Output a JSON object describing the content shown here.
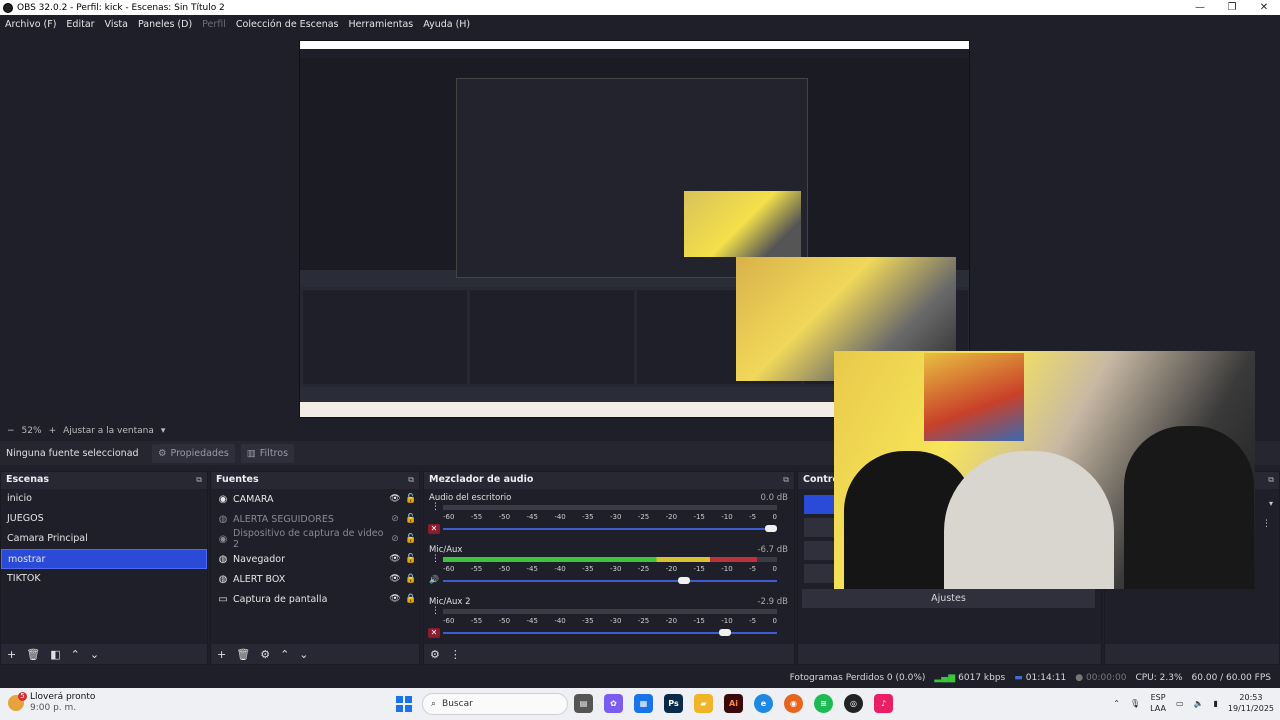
{
  "window": {
    "title": "OBS 32.0.2 - Perfil: kick - Escenas: Sin Título 2",
    "minimize": "—",
    "maximize": "❐",
    "close": "✕"
  },
  "menu": [
    "Archivo (F)",
    "Editar",
    "Vista",
    "Paneles (D)",
    "Perfil",
    "Colección de Escenas",
    "Herramientas",
    "Ayuda (H)"
  ],
  "zoom": {
    "minus": "−",
    "value": "52%",
    "plus": "+",
    "fit": "Ajustar a la ventana"
  },
  "properties_bar": {
    "no_selection": "Ninguna fuente seleccionad",
    "properties": "Propiedades",
    "filters": "Filtros"
  },
  "scenes": {
    "title": "Escenas",
    "items": [
      "inicio",
      "JUEGOS",
      "Camara Principal",
      "mostrar",
      "TIKTOK"
    ],
    "active_index": 3
  },
  "sources": {
    "title": "Fuentes",
    "items": [
      {
        "name": "CAMARA",
        "icon": "camera-icon",
        "visible": true,
        "locked": false
      },
      {
        "name": "ALERTA SEGUIDORES",
        "icon": "globe-icon",
        "visible": false,
        "locked": false
      },
      {
        "name": "Dispositivo de captura de video 2",
        "icon": "camera-icon",
        "visible": false,
        "locked": false
      },
      {
        "name": "Navegador",
        "icon": "globe-icon",
        "visible": true,
        "locked": false
      },
      {
        "name": "ALERT BOX",
        "icon": "globe-icon",
        "visible": true,
        "locked": true
      },
      {
        "name": "Captura de pantalla",
        "icon": "monitor-icon",
        "visible": true,
        "locked": true
      }
    ]
  },
  "mixer": {
    "title": "Mezclador de audio",
    "scale": [
      "-60",
      "-55",
      "-50",
      "-45",
      "-40",
      "-35",
      "-30",
      "-25",
      "-20",
      "-15",
      "-10",
      "-5",
      "0"
    ],
    "channels": [
      {
        "name": "Audio del escritorio",
        "db": "0.0 dB",
        "level": 0.0,
        "volume": 1.0,
        "muted": true
      },
      {
        "name": "Mic/Aux",
        "db": "-6.7 dB",
        "level": 0.94,
        "volume": 0.72,
        "muted": false
      },
      {
        "name": "Mic/Aux 2",
        "db": "-2.9 dB",
        "level": 0.0,
        "volume": 0.85,
        "muted": true
      }
    ]
  },
  "controls": {
    "title": "Contro",
    "settings_label": "Ajustes"
  },
  "status": {
    "dropped": "Fotogramas Perdidos 0 (0.0%)",
    "bitrate": "6017 kbps",
    "stream_time": "01:14:11",
    "rec_time": "00:00:00",
    "cpu": "CPU: 2.3%",
    "fps": "60.00 / 60.00 FPS"
  },
  "taskbar": {
    "weather_title": "Lloverá pronto",
    "weather_time": "9:00 p. m.",
    "weather_badge": "5",
    "search": "Buscar",
    "language": "ESP",
    "language2": "LAA",
    "time": "20:53",
    "date": "19/11/2025",
    "icons": [
      {
        "name": "file-explorer-icon",
        "color": "#555555",
        "glyph": "▤"
      },
      {
        "name": "copilot-icon",
        "color": "#7b5cf0",
        "glyph": "✿"
      },
      {
        "name": "store-icon",
        "color": "#1a73e8",
        "glyph": "▦"
      },
      {
        "name": "photoshop-icon",
        "color": "#0a2a4a",
        "glyph": "Ps"
      },
      {
        "name": "folder-icon",
        "color": "#f0b429",
        "glyph": "▰"
      },
      {
        "name": "illustrator-icon",
        "color": "#3a0a0a",
        "glyph": "Ai"
      },
      {
        "name": "edge-icon",
        "color": "#1e88e5",
        "glyph": "e"
      },
      {
        "name": "firefox-icon",
        "color": "#e8631c",
        "glyph": "◉"
      },
      {
        "name": "spotify-icon",
        "color": "#1db954",
        "glyph": "≋"
      },
      {
        "name": "obs-icon",
        "color": "#222222",
        "glyph": "◎"
      },
      {
        "name": "tiktok-icon",
        "color": "#e91e63",
        "glyph": "♪"
      }
    ]
  },
  "colors": {
    "accent": "#2a4bd8",
    "meter_green": "#3cc43c",
    "meter_yellow": "#d8c030",
    "meter_red": "#c0303a",
    "mute_red": "#8a1c2c"
  }
}
